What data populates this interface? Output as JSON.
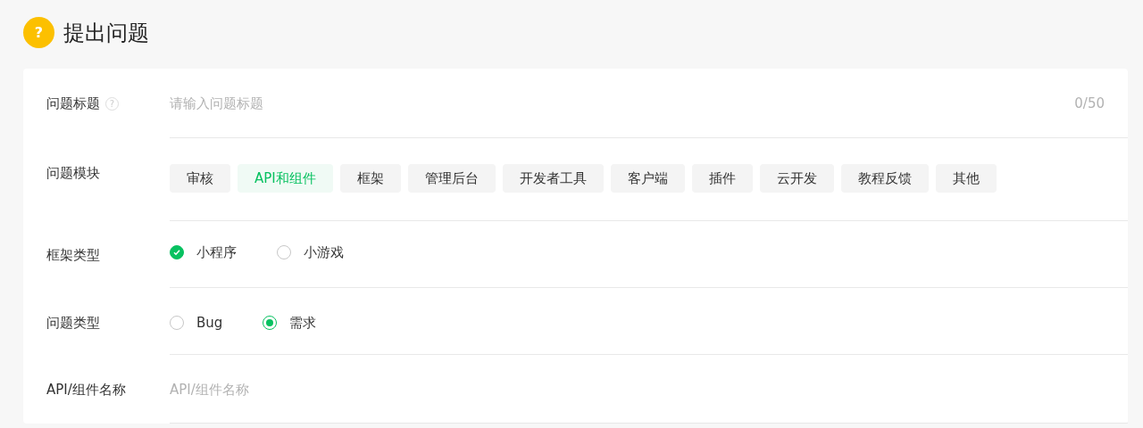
{
  "page": {
    "title": "提出问题",
    "title_icon": "?"
  },
  "form": [
    {
      "kind": "text",
      "label": "问题标题",
      "help": "?",
      "placeholder": "请输入问题标题",
      "counter": "0/50"
    },
    {
      "kind": "tags",
      "label": "问题模块",
      "options": [
        {
          "label": "审核",
          "selected": false
        },
        {
          "label": "API和组件",
          "selected": true
        },
        {
          "label": "框架",
          "selected": false
        },
        {
          "label": "管理后台",
          "selected": false
        },
        {
          "label": "开发者工具",
          "selected": false
        },
        {
          "label": "客户端",
          "selected": false
        },
        {
          "label": "插件",
          "selected": false
        },
        {
          "label": "云开发",
          "selected": false
        },
        {
          "label": "教程反馈",
          "selected": false
        },
        {
          "label": "其他",
          "selected": false
        }
      ]
    },
    {
      "kind": "checkradio",
      "label": "框架类型",
      "options": [
        {
          "label": "小程序",
          "selected": true
        },
        {
          "label": "小游戏",
          "selected": false
        }
      ]
    },
    {
      "kind": "radio",
      "label": "问题类型",
      "options": [
        {
          "label": "Bug",
          "selected": false
        },
        {
          "label": "需求",
          "selected": true
        }
      ]
    },
    {
      "kind": "text",
      "label": "API/组件名称",
      "placeholder": "API/组件名称"
    }
  ]
}
